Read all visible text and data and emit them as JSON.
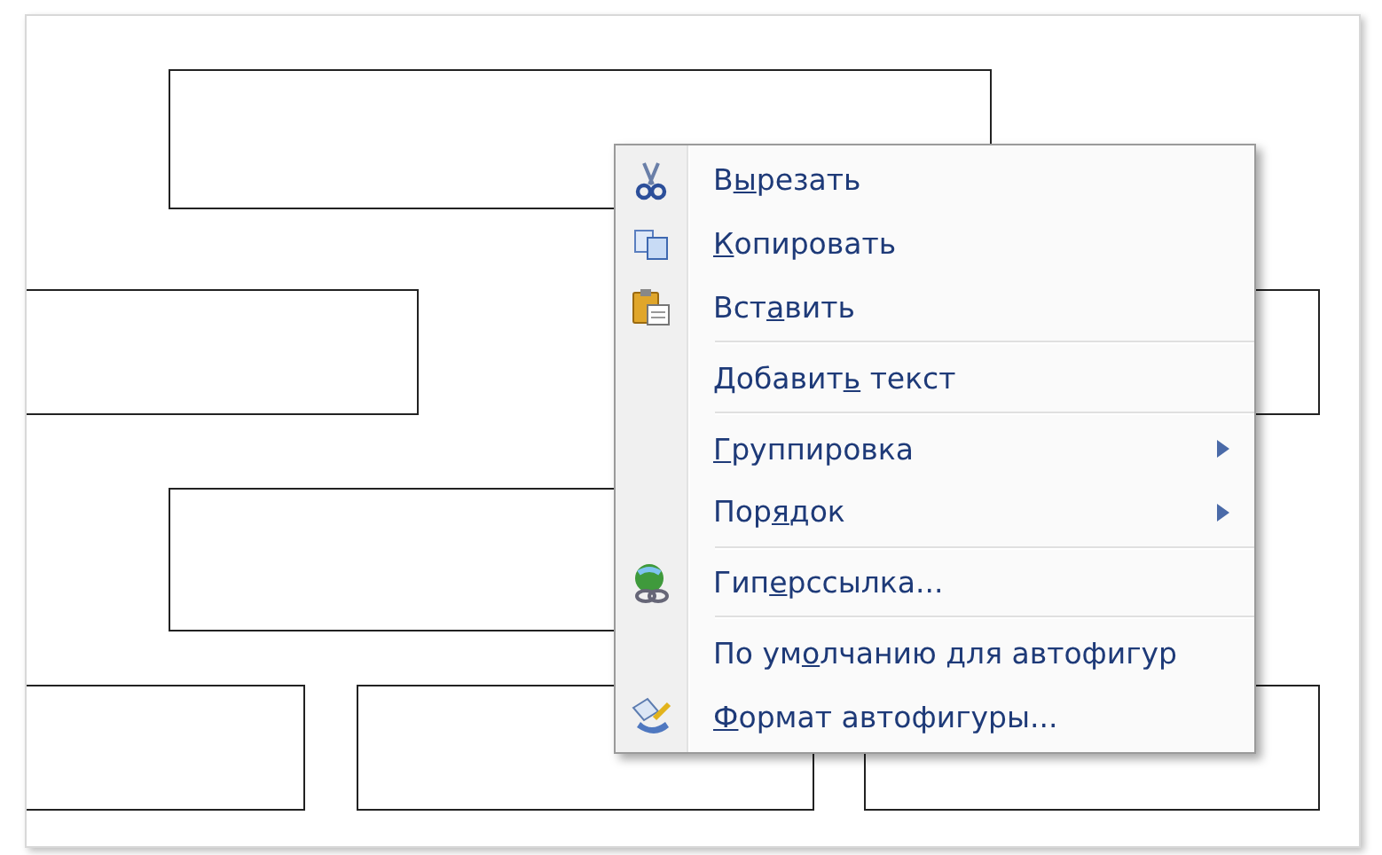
{
  "context_menu": {
    "items": [
      {
        "kind": "cut",
        "pre": "В",
        "key": "ы",
        "post": "резать"
      },
      {
        "kind": "copy",
        "key": "К",
        "post": "опировать"
      },
      {
        "kind": "paste",
        "pre": "Вст",
        "key": "а",
        "post": "вить"
      },
      {
        "kind": "separator"
      },
      {
        "kind": "plain",
        "pre": "Добавит",
        "key": "ь",
        "post": " текст"
      },
      {
        "kind": "separator"
      },
      {
        "kind": "submenu",
        "key": "Г",
        "post": "руппировка"
      },
      {
        "kind": "submenu",
        "pre": "Пор",
        "key": "я",
        "post": "док"
      },
      {
        "kind": "separator"
      },
      {
        "kind": "link",
        "pre": "Гип",
        "key": "е",
        "post": "рссылка..."
      },
      {
        "kind": "separator"
      },
      {
        "kind": "plain",
        "pre": "По ум",
        "key": "о",
        "post": "лчанию для автофигур"
      },
      {
        "kind": "format",
        "key": "Ф",
        "post": "ормат автофигуры..."
      }
    ]
  }
}
